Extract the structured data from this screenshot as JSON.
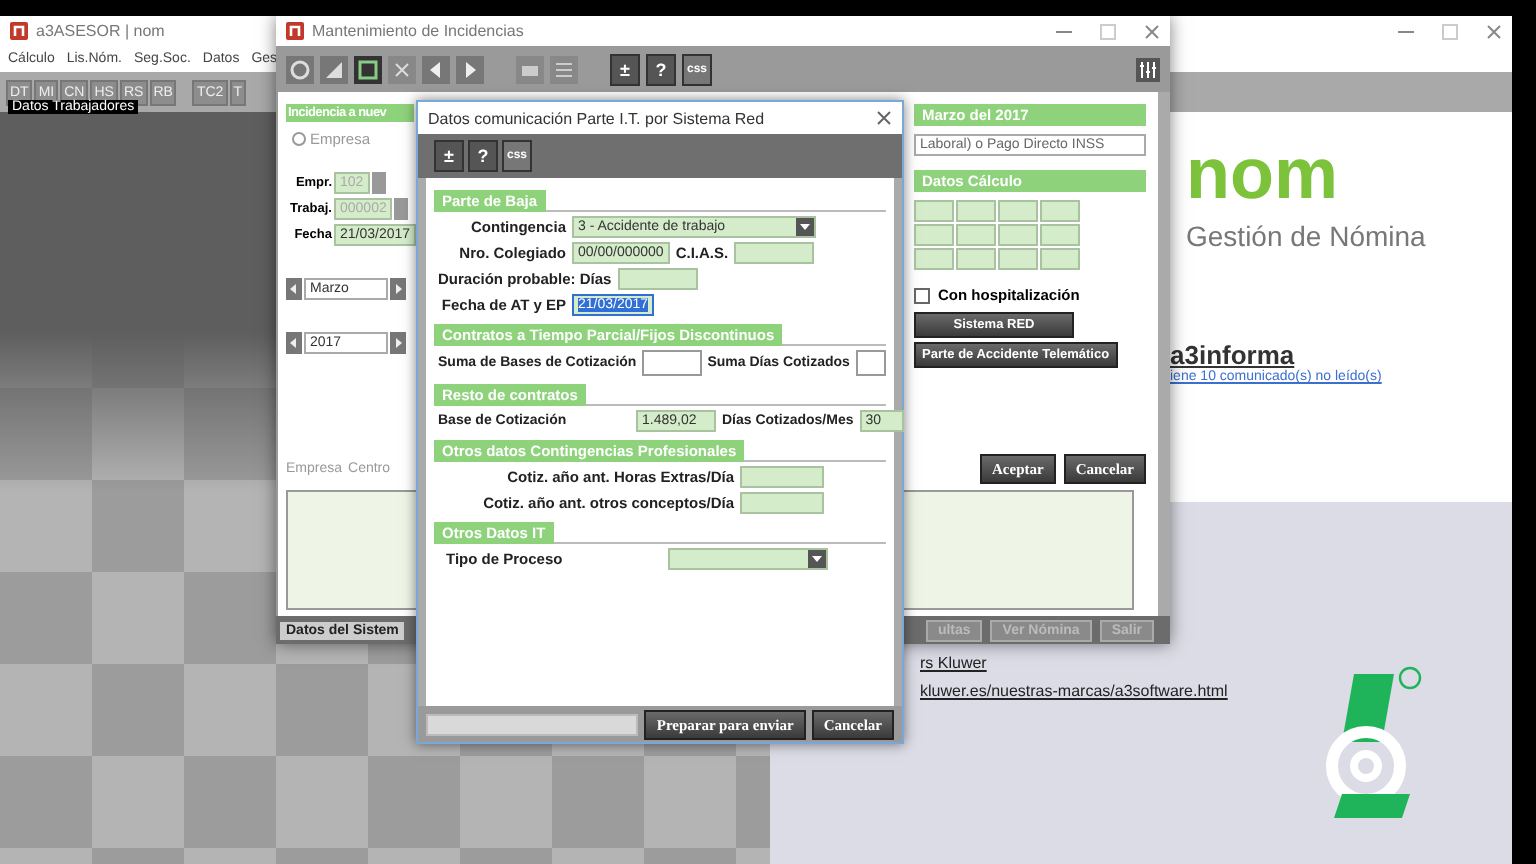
{
  "desktop_window": {
    "title": "a3ASESOR | nom",
    "menu": [
      "Cálculo",
      "Lis.Nóm.",
      "Seg.Soc.",
      "Datos",
      "Ges"
    ],
    "toolbar": [
      "DT",
      "MI",
      "CN",
      "HS",
      "RS",
      "RB",
      "TC2",
      "T"
    ],
    "tooltip": "Datos Trabajadores",
    "brand": {
      "logo": "nom",
      "subtitle": "Gestión de Nómina",
      "news_title": "a3informa",
      "news_link": "iene 10 comunicado(s) no leído(s)"
    },
    "links": [
      "rs Kluwer",
      "kluwer.es/nuestras-marcas/a3software.html"
    ]
  },
  "incidencias_window": {
    "title": "Mantenimiento de Incidencias",
    "toolbar": [
      "±",
      "?",
      "css"
    ],
    "header": "Incidencia a nuev",
    "radios": [
      {
        "label": "Empresa",
        "selected": false
      }
    ],
    "fields": [
      {
        "label": "Empr.",
        "value": "102",
        "disabled": true
      },
      {
        "label": "Trabaj.",
        "value": "000002",
        "disabled": true
      },
      {
        "label": "Fecha",
        "value": "21/03/2017",
        "disabled": false
      }
    ],
    "spinners": [
      "Marzo",
      "2017"
    ],
    "period_header": "Marzo del 2017",
    "payment_field": "Laboral) o Pago Directo INSS",
    "calc_header": "Datos Cálculo",
    "hospitalization": {
      "label": "Con hospitalización",
      "checked": false
    },
    "action_buttons": [
      "Sistema RED",
      "Parte de Accidente Telemático"
    ],
    "list_labels": [
      "Empresa",
      "Centro"
    ],
    "dialog_buttons": [
      "Aceptar",
      "Cancelar"
    ],
    "bottom_tabs": [
      {
        "label": "Datos del Sistem",
        "disabled": false
      },
      {
        "label": "ultas",
        "disabled": true
      },
      {
        "label": "Ver Nómina",
        "disabled": true
      },
      {
        "label": "Salir",
        "disabled": true
      }
    ]
  },
  "dialog": {
    "title": "Datos comunicación Parte I.T. por Sistema Red",
    "toolbar": [
      "±",
      "?",
      "css"
    ],
    "sections": [
      {
        "title": "Parte de Baja",
        "rows": [
          {
            "items": [
              {
                "kind": "label",
                "text": "Contingencia"
              },
              {
                "kind": "select",
                "value": "3 - Accidente de trabajo"
              }
            ]
          },
          {
            "items": [
              {
                "kind": "label",
                "text": "Nro. Colegiado"
              },
              {
                "kind": "field",
                "value": "00/00/000000",
                "selected": false
              },
              {
                "kind": "label",
                "text": "C.I.A.S."
              },
              {
                "kind": "field",
                "selected": false
              }
            ]
          },
          {
            "items": [
              {
                "kind": "label",
                "text": "Duración probable: Días"
              },
              {
                "kind": "field",
                "selected": false
              }
            ]
          },
          {
            "items": [
              {
                "kind": "label",
                "text": "Fecha de AT y EP"
              },
              {
                "kind": "field",
                "value": "21/03/2017",
                "selected": true
              }
            ]
          }
        ]
      },
      {
        "title": "Contratos a Tiempo Parcial/Fijos Discontinuos",
        "rows": [
          {
            "items": [
              {
                "kind": "label",
                "text": "Suma de Bases de Cotización"
              },
              {
                "kind": "input"
              },
              {
                "kind": "label",
                "text": "Suma Días Cotizados"
              },
              {
                "kind": "input"
              }
            ]
          }
        ]
      },
      {
        "title": "Resto de contratos",
        "rows": [
          {
            "items": [
              {
                "kind": "label",
                "text": "Base de Cotización"
              },
              {
                "kind": "field",
                "value": "1.489,02",
                "selected": false
              },
              {
                "kind": "label",
                "text": "Días Cotizados/Mes"
              },
              {
                "kind": "field",
                "value": "30",
                "selected": false
              }
            ]
          }
        ]
      },
      {
        "title": "Otros datos Contingencias Profesionales",
        "rows": [
          {
            "items": [
              {
                "kind": "label",
                "text": "Cotiz. año ant. Horas Extras/Día"
              },
              {
                "kind": "field",
                "selected": false
              }
            ]
          },
          {
            "items": [
              {
                "kind": "label",
                "text": "Cotiz. año ant. otros conceptos/Día"
              },
              {
                "kind": "field",
                "selected": false
              }
            ]
          }
        ]
      },
      {
        "title": "Otros Datos IT",
        "rows": [
          {
            "items": [
              {
                "kind": "label",
                "text": "Tipo de Proceso"
              },
              {
                "kind": "select"
              }
            ]
          }
        ]
      }
    ],
    "footer_buttons": [
      "Preparar para enviar",
      "Cancelar"
    ]
  }
}
